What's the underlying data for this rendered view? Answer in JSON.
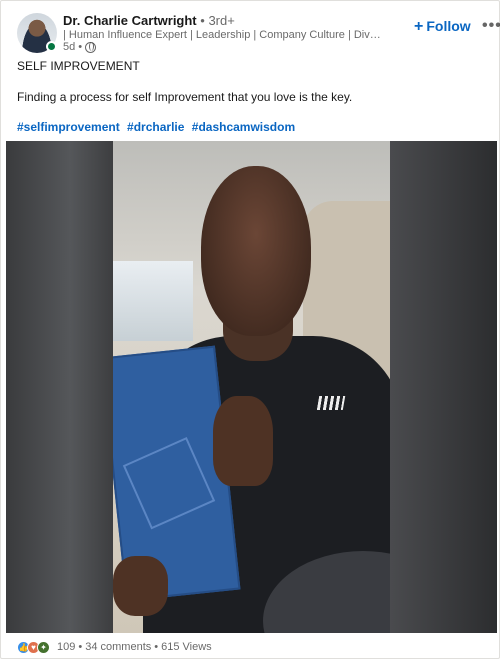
{
  "author": {
    "name": "Dr. Charlie Cartwright",
    "degree": "3rd+",
    "headline": "| Human Influence Expert | Leadership | Company Culture | Diversity & Inclusion",
    "time": "5d",
    "visibility_icon": "globe-icon"
  },
  "actions": {
    "follow_label": "Follow",
    "more_label": "•••"
  },
  "post": {
    "title": "SELF IMPROVEMENT",
    "body": "Finding a process for self Improvement that you love is the key.",
    "hashtags": [
      "#selfimprovement",
      "#drcharlie",
      "#dashcamwisdom"
    ]
  },
  "video": {
    "content": "man-in-car-holding-notebook",
    "icon": "video-player"
  },
  "social": {
    "reaction_icons": [
      "like-icon",
      "love-icon",
      "insightful-icon"
    ],
    "reaction_count": "109",
    "comments": "34 comments",
    "views": "615 Views"
  },
  "colors": {
    "link": "#0a66c2",
    "presence": "#057642",
    "like": "#378fe9",
    "love": "#df704d",
    "insight": "#44712e"
  }
}
